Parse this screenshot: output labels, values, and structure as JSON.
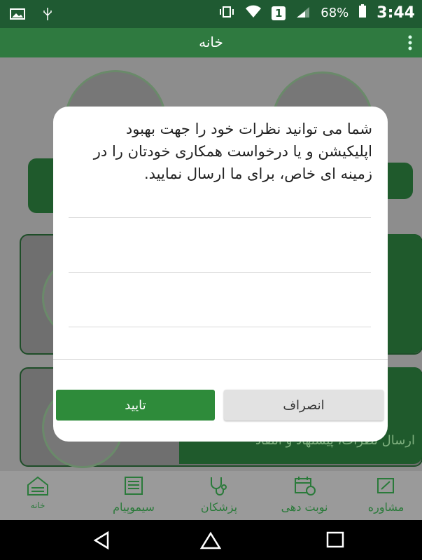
{
  "status_bar": {
    "battery": "68%",
    "time": "3:44",
    "notification_count": "1"
  },
  "toolbar": {
    "title": "خانه"
  },
  "background": {
    "banner_text": "ارسال نظرات، پیشنهاد و انتقاد"
  },
  "dialog": {
    "message": "شما می توانید نظرات خود را جهت بهبود اپلیکیشن و یا درخواست همکاری خودتان را در زمینه ای خاص، برای ما ارسال نمایید.",
    "confirm_label": "تایید",
    "cancel_label": "انصراف"
  },
  "bottom_nav": {
    "items": [
      {
        "label": "خانه",
        "icon": "home-icon"
      },
      {
        "label": "سیموپیام",
        "icon": "newspaper-icon"
      },
      {
        "label": "پزشکان",
        "icon": "stethoscope-icon"
      },
      {
        "label": "نوبت دهی",
        "icon": "calendar-clock-icon"
      },
      {
        "label": "مشاوره",
        "icon": "consult-icon"
      }
    ]
  },
  "colors": {
    "primary_dark": "#1f5a32",
    "primary": "#2f7a40",
    "accent": "#2e8b3a"
  }
}
